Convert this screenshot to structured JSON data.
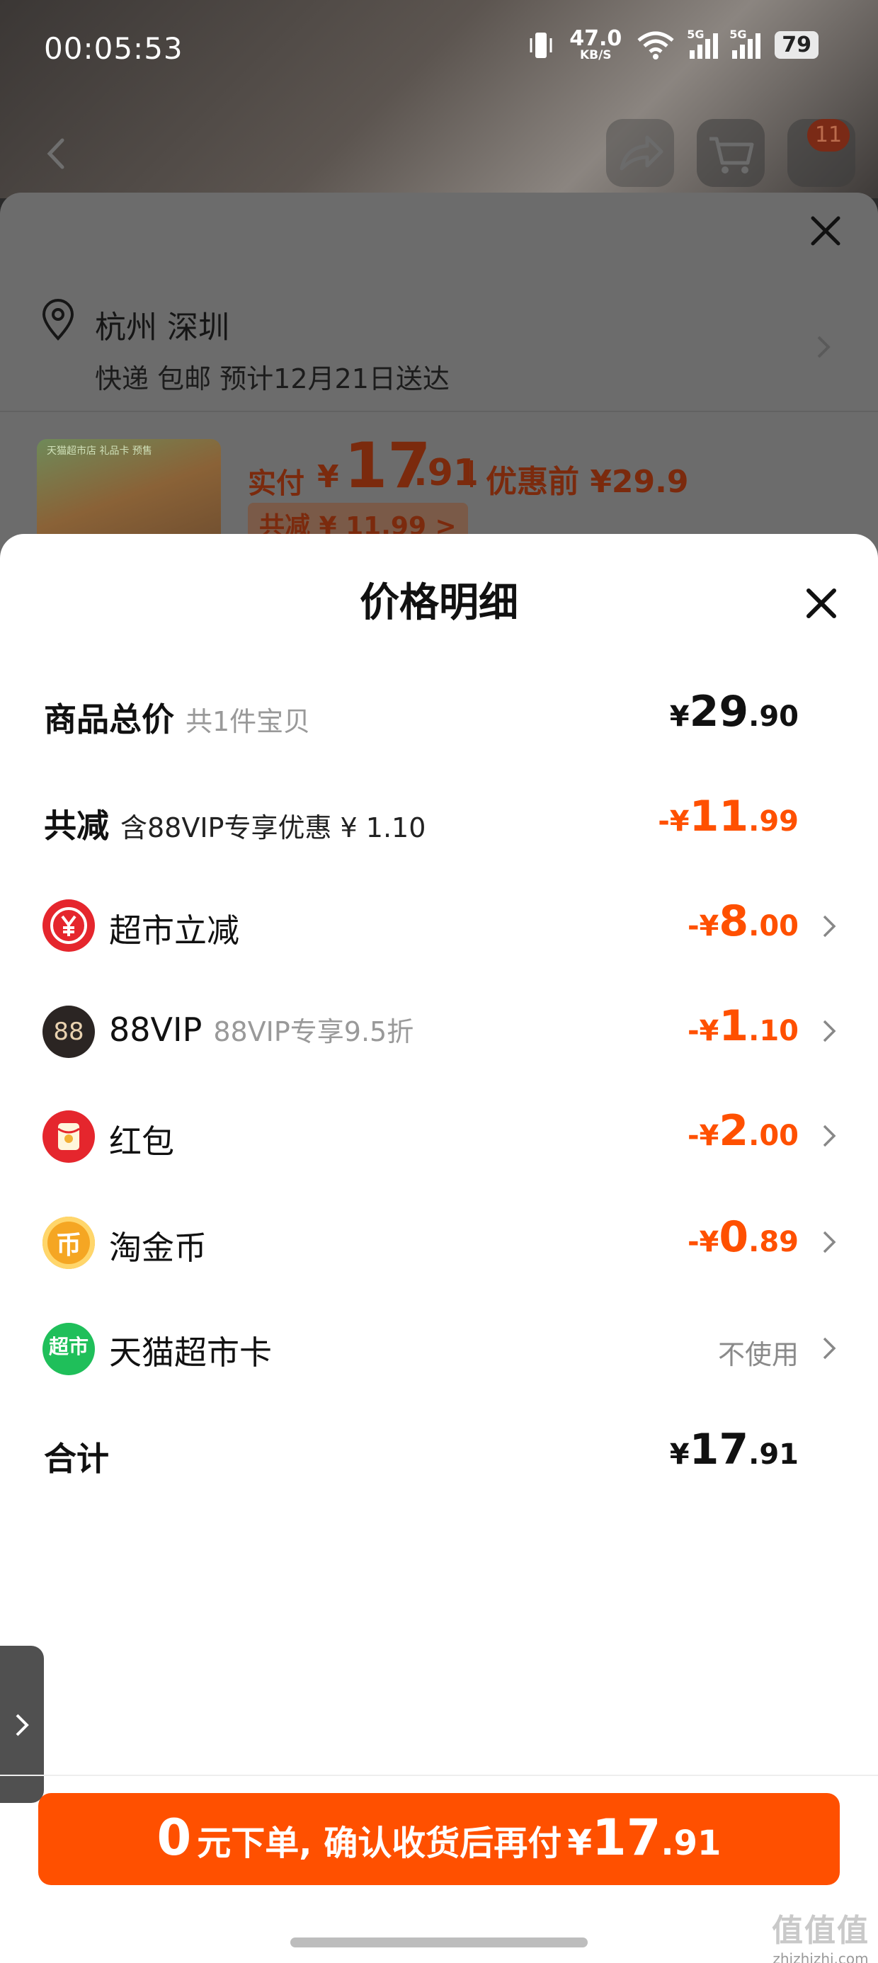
{
  "status_bar": {
    "time": "00:05:53",
    "net_speed": "47.0",
    "net_speed_unit": "KB/S",
    "sim1": "5G",
    "sim2": "5G",
    "battery": "79"
  },
  "background_header": {
    "cart_badge": "11"
  },
  "address_sheet": {
    "city": "杭州 深圳",
    "delivery": "快递 包邮 预计12月21日送达",
    "thumb_caption": "天猫超市店 礼品卡  预售",
    "paid_label": "实付",
    "paid_yen": "¥",
    "paid_int": "17",
    "paid_dec": ".91",
    "before_discount": "优惠前 ¥29.9",
    "total_saved": "共减 ¥ 11.99 >"
  },
  "price_detail": {
    "title": "价格明细",
    "rows": {
      "goods_total": {
        "label": "商品总价",
        "sub": "共1件宝贝",
        "yen": "¥",
        "int": "29",
        "dec": ".90"
      },
      "discount_total": {
        "label": "共减",
        "sub": "含88VIP专享优惠 ¥ 1.10",
        "yen": "-¥",
        "int": "11",
        "dec": ".99"
      },
      "supermarket_discount": {
        "label": "超市立减",
        "icon": "yuan-icon",
        "yen": "-¥",
        "int": "8",
        "dec": ".00"
      },
      "vip88": {
        "label": "88VIP",
        "sub": "88VIP专享9.5折",
        "icon_text": "88",
        "yen": "-¥",
        "int": "1",
        "dec": ".10"
      },
      "red_packet": {
        "label": "红包",
        "icon": "red-packet-icon",
        "yen": "-¥",
        "int": "2",
        "dec": ".00"
      },
      "taojinbi": {
        "label": "淘金币",
        "icon": "gold-coin-icon",
        "icon_text": "币",
        "yen": "-¥",
        "int": "0",
        "dec": ".89"
      },
      "supermarket_card": {
        "label": "天猫超市卡",
        "icon_text": "超市",
        "value": "不使用"
      },
      "grand_total": {
        "label": "合计",
        "yen": "¥",
        "int": "17",
        "dec": ".91"
      }
    },
    "order_button": {
      "lead": "0",
      "text": "元下单, 确认收货后再付",
      "yen": "¥",
      "int": "17",
      "dec": ".91"
    }
  },
  "watermark": {
    "logo": "值值值",
    "domain": "zhizhizhi.com"
  },
  "colors": {
    "accent_orange": "#ff5000",
    "supermarket_red": "#e5262d",
    "vip_black": "#2b2523",
    "coin_gold": "#f5a623",
    "card_green": "#1fbf5a"
  }
}
